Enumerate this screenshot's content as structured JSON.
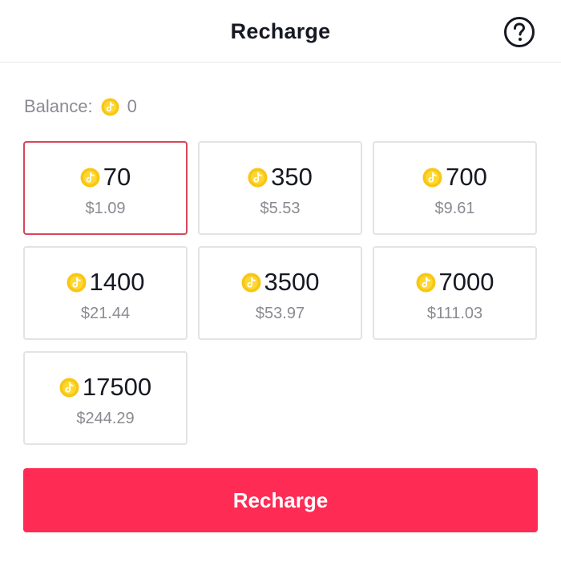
{
  "header": {
    "title": "Recharge",
    "help_icon": "question-circle-icon"
  },
  "balance": {
    "label": "Balance:",
    "value": "0",
    "icon": "coin-icon"
  },
  "packages": [
    {
      "coins": "70",
      "price": "$1.09",
      "selected": true
    },
    {
      "coins": "350",
      "price": "$5.53",
      "selected": false
    },
    {
      "coins": "700",
      "price": "$9.61",
      "selected": false
    },
    {
      "coins": "1400",
      "price": "$21.44",
      "selected": false
    },
    {
      "coins": "3500",
      "price": "$53.97",
      "selected": false
    },
    {
      "coins": "7000",
      "price": "$111.03",
      "selected": false
    },
    {
      "coins": "17500",
      "price": "$244.29",
      "selected": false
    }
  ],
  "actions": {
    "recharge_label": "Recharge"
  },
  "colors": {
    "accent": "#fe2c55",
    "selected_border": "#d8465a",
    "coin": "#f9c614",
    "text_primary": "#161823",
    "text_secondary": "#8a8b91"
  }
}
